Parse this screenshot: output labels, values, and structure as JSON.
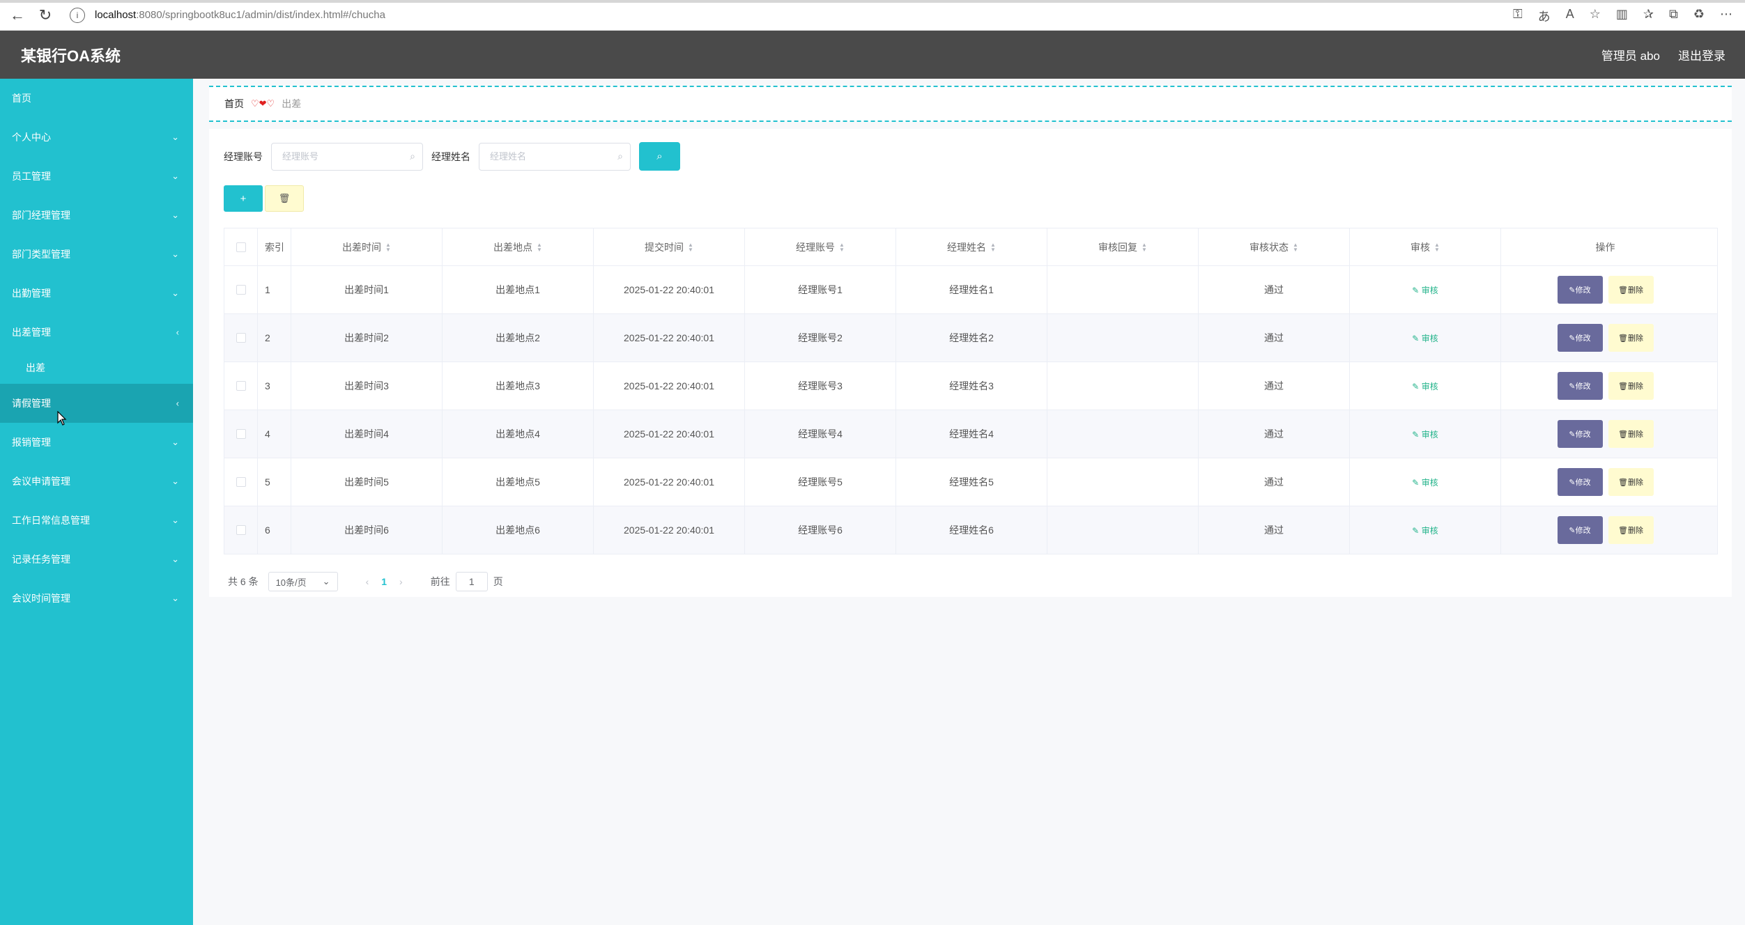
{
  "browser": {
    "url_host": "localhost",
    "url_path": ":8080/springbootk8uc1/admin/dist/index.html#/chucha"
  },
  "header": {
    "title": "某银行OA系统",
    "user_label": "管理员 abo",
    "logout_label": "退出登录"
  },
  "sidebar": {
    "items": [
      {
        "label": "首页",
        "arrow": ""
      },
      {
        "label": "个人中心",
        "arrow": "⌄"
      },
      {
        "label": "员工管理",
        "arrow": "⌄"
      },
      {
        "label": "部门经理管理",
        "arrow": "⌄"
      },
      {
        "label": "部门类型管理",
        "arrow": "⌄"
      },
      {
        "label": "出勤管理",
        "arrow": "⌄"
      },
      {
        "label": "出差管理",
        "arrow": "‹"
      },
      {
        "label": "出差",
        "sub": true
      },
      {
        "label": "请假管理",
        "arrow": "‹",
        "active": true
      },
      {
        "label": "报销管理",
        "arrow": "⌄"
      },
      {
        "label": "会议申请管理",
        "arrow": "⌄"
      },
      {
        "label": "工作日常信息管理",
        "arrow": "⌄"
      },
      {
        "label": "记录任务管理",
        "arrow": "⌄"
      },
      {
        "label": "会议时间管理",
        "arrow": "⌄"
      }
    ]
  },
  "breadcrumb": {
    "home": "首页",
    "current": "出差"
  },
  "search": {
    "account_label": "经理账号",
    "account_placeholder": "经理账号",
    "name_label": "经理姓名",
    "name_placeholder": "经理姓名"
  },
  "table": {
    "headers": [
      "索引",
      "出差时间",
      "出差地点",
      "提交时间",
      "经理账号",
      "经理姓名",
      "审核回复",
      "审核状态",
      "审核",
      "操作"
    ],
    "rows": [
      {
        "idx": "1",
        "time": "出差时间1",
        "place": "出差地点1",
        "submitted": "2025-01-22 20:40:01",
        "account": "经理账号1",
        "name": "经理姓名1",
        "reply": "",
        "status": "通过"
      },
      {
        "idx": "2",
        "time": "出差时间2",
        "place": "出差地点2",
        "submitted": "2025-01-22 20:40:01",
        "account": "经理账号2",
        "name": "经理姓名2",
        "reply": "",
        "status": "通过"
      },
      {
        "idx": "3",
        "time": "出差时间3",
        "place": "出差地点3",
        "submitted": "2025-01-22 20:40:01",
        "account": "经理账号3",
        "name": "经理姓名3",
        "reply": "",
        "status": "通过"
      },
      {
        "idx": "4",
        "time": "出差时间4",
        "place": "出差地点4",
        "submitted": "2025-01-22 20:40:01",
        "account": "经理账号4",
        "name": "经理姓名4",
        "reply": "",
        "status": "通过"
      },
      {
        "idx": "5",
        "time": "出差时间5",
        "place": "出差地点5",
        "submitted": "2025-01-22 20:40:01",
        "account": "经理账号5",
        "name": "经理姓名5",
        "reply": "",
        "status": "通过"
      },
      {
        "idx": "6",
        "time": "出差时间6",
        "place": "出差地点6",
        "submitted": "2025-01-22 20:40:01",
        "account": "经理账号6",
        "name": "经理姓名6",
        "reply": "",
        "status": "通过"
      }
    ],
    "audit_label": "审核",
    "edit_label": "修改",
    "delete_label": "删除"
  },
  "pagination": {
    "total": "共 6 条",
    "page_size": "10条/页",
    "current_page": "1",
    "goto_prefix": "前往",
    "goto_value": "1",
    "goto_suffix": "页"
  },
  "colors": {
    "accent": "#22c1cf",
    "header_bg": "#4a4a4a",
    "edit_btn": "#696a9c",
    "delete_btn": "#fffbd0"
  }
}
